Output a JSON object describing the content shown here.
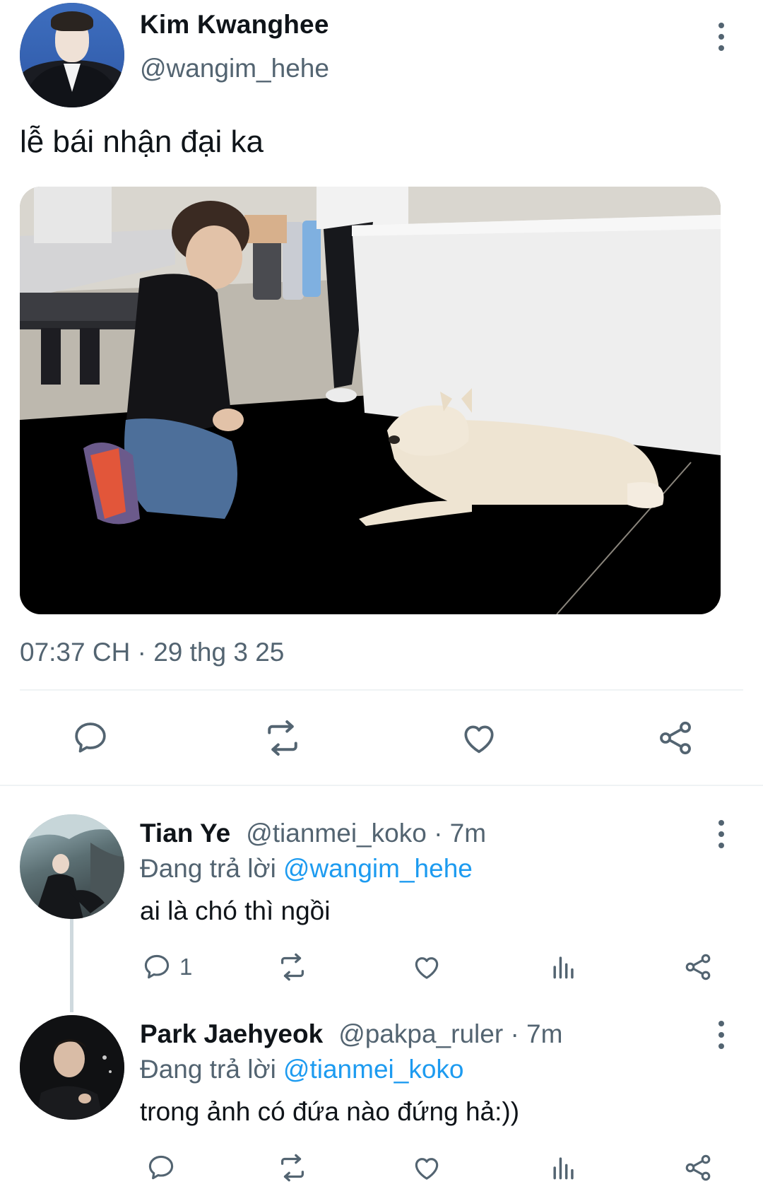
{
  "main_tweet": {
    "author_name": "Kim Kwanghee",
    "author_handle": "@wangim_hehe",
    "text": "lễ bái nhận đại ka",
    "timestamp": "07:37 CH · 29 thg 3 25",
    "actions": {
      "reply_icon": "comment-icon",
      "retweet_icon": "retweet-icon",
      "like_icon": "heart-icon",
      "share_icon": "share-icon"
    }
  },
  "replies": [
    {
      "author_name": "Tian Ye",
      "author_handle": "@tianmei_koko",
      "time": "· 7m",
      "replying_prefix": "Đang trả lời",
      "replying_to": "@wangim_hehe",
      "text": "ai là chó thì ngồi",
      "reply_count": "1"
    },
    {
      "author_name": "Park Jaehyeok",
      "author_handle": "@pakpa_ruler",
      "time": "· 7m",
      "replying_prefix": "Đang trả lời",
      "replying_to": "@tianmei_koko",
      "text": "trong ảnh có đứa nào đứng hả:))",
      "reply_count": ""
    }
  ],
  "colors": {
    "text": "#0f1419",
    "secondary": "#536471",
    "link": "#1d9bf0",
    "divider": "#eff3f4"
  }
}
